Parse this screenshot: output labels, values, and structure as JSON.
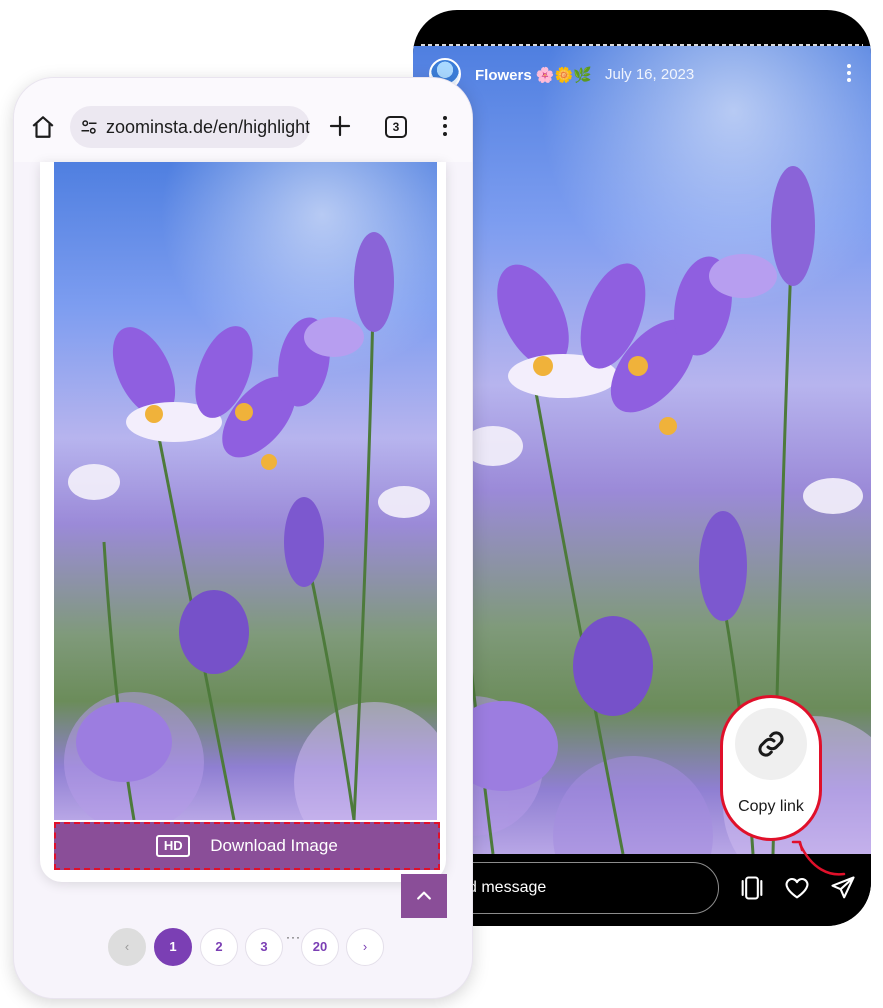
{
  "story": {
    "username": "Flowers 🌸🌼🌿",
    "date": "July 16, 2023",
    "message_placeholder": "d message",
    "copy_link_label": "Copy link"
  },
  "browser": {
    "url": "zoominsta.de/en/highlights",
    "tab_count": "3"
  },
  "page": {
    "hd_label": "HD",
    "download_label": "Download Image"
  },
  "pagination": {
    "prev": "‹",
    "pages": [
      "1",
      "2",
      "3",
      "20"
    ],
    "ellipsis": "···",
    "next": "›",
    "active": "1"
  },
  "colors": {
    "accent": "#8a4e98",
    "pagination_accent": "#7b3fb4",
    "highlight_outline": "#e0102a"
  },
  "icons": {
    "home": "home-icon",
    "tune": "tune-icon",
    "plus": "plus-icon",
    "tabs": "tabs-icon",
    "menu": "more-vertical-icon",
    "link": "link-icon",
    "heart": "heart-icon",
    "send": "send-icon",
    "stack": "stack-icon",
    "scroll_top": "chevron-up-icon"
  }
}
